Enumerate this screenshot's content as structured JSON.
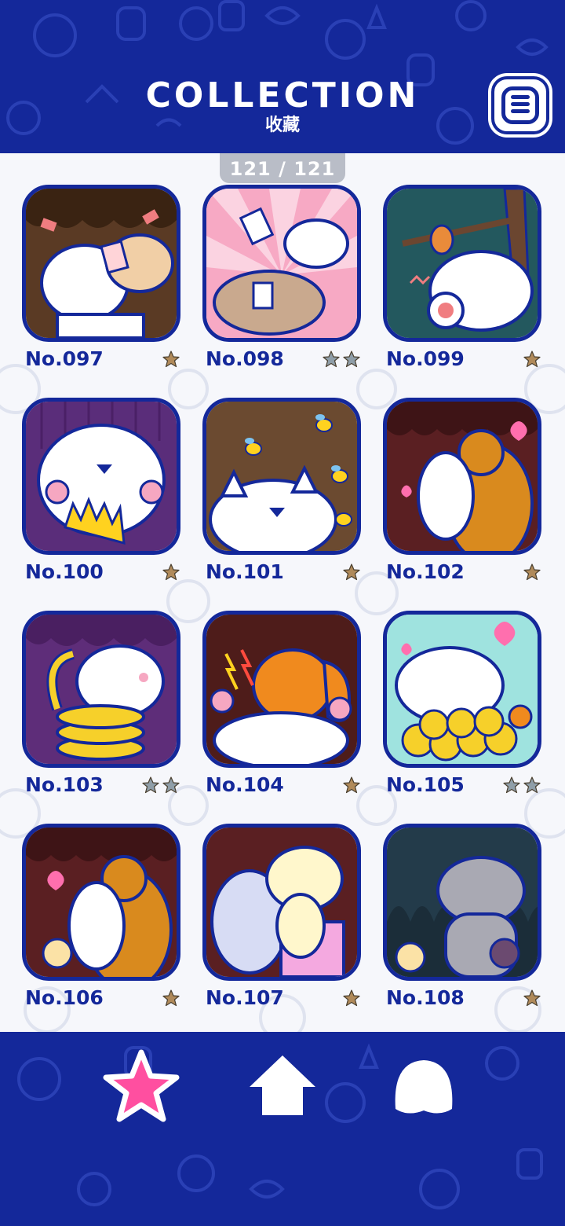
{
  "header": {
    "title": "COLLECTION",
    "subtitle": "收藏"
  },
  "counter": "121 / 121",
  "colors": {
    "brand": "#14289a",
    "star_bronze": "#b08a5a",
    "star_silver": "#8f9ea8",
    "nav_active": "#ff4fa0"
  },
  "items": [
    {
      "label": "No.097",
      "stars": 1,
      "star_color": "bronze",
      "bg": "#5a3a24"
    },
    {
      "label": "No.098",
      "stars": 2,
      "star_color": "silver",
      "bg": "#f7a9c4"
    },
    {
      "label": "No.099",
      "stars": 1,
      "star_color": "bronze",
      "bg": "#23585e"
    },
    {
      "label": "No.100",
      "stars": 1,
      "star_color": "bronze",
      "bg": "#5a2d7a"
    },
    {
      "label": "No.101",
      "stars": 1,
      "star_color": "bronze",
      "bg": "#6b4a30"
    },
    {
      "label": "No.102",
      "stars": 1,
      "star_color": "bronze",
      "bg": "#5a1f22"
    },
    {
      "label": "No.103",
      "stars": 2,
      "star_color": "silver",
      "bg": "#5e2d79"
    },
    {
      "label": "No.104",
      "stars": 1,
      "star_color": "bronze",
      "bg": "#4e1c1a"
    },
    {
      "label": "No.105",
      "stars": 2,
      "star_color": "silver",
      "bg": "#9fe3df"
    },
    {
      "label": "No.106",
      "stars": 1,
      "star_color": "bronze",
      "bg": "#5a1f22"
    },
    {
      "label": "No.107",
      "stars": 1,
      "star_color": "bronze",
      "bg": "#5a1f22"
    },
    {
      "label": "No.108",
      "stars": 1,
      "star_color": "bronze",
      "bg": "#233b4a"
    }
  ],
  "nav": [
    {
      "icon": "star-icon",
      "active": true
    },
    {
      "icon": "home-icon",
      "active": false
    },
    {
      "icon": "character-icon",
      "active": false
    }
  ]
}
